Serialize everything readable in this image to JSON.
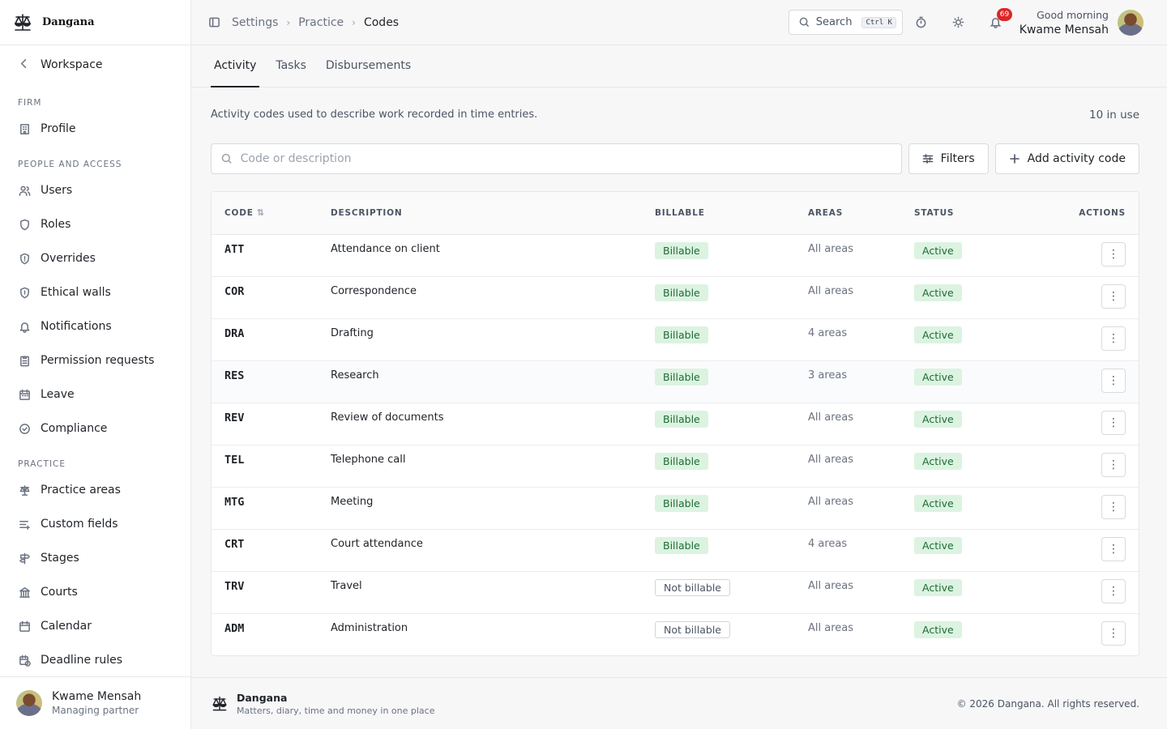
{
  "brand": {
    "name": "Dangana",
    "logo_icon": "scales-of-justice-icon"
  },
  "sidebar": {
    "back_label": "Workspace",
    "sections": [
      {
        "title": "FIRM",
        "items": [
          {
            "label": "Profile",
            "icon": "building-icon"
          }
        ]
      },
      {
        "title": "PEOPLE AND ACCESS",
        "items": [
          {
            "label": "Users",
            "icon": "users-icon"
          },
          {
            "label": "Roles",
            "icon": "shield-icon"
          },
          {
            "label": "Overrides",
            "icon": "shield-alert-icon"
          },
          {
            "label": "Ethical walls",
            "icon": "shield-lock-icon"
          },
          {
            "label": "Notifications",
            "icon": "bell-icon"
          },
          {
            "label": "Permission requests",
            "icon": "clipboard-icon"
          },
          {
            "label": "Leave",
            "icon": "calendar-icon"
          },
          {
            "label": "Compliance",
            "icon": "check-circle-icon"
          }
        ]
      },
      {
        "title": "PRACTICE",
        "items": [
          {
            "label": "Practice areas",
            "icon": "scales-icon"
          },
          {
            "label": "Custom fields",
            "icon": "list-plus-icon"
          },
          {
            "label": "Stages",
            "icon": "signpost-icon"
          },
          {
            "label": "Courts",
            "icon": "landmark-icon"
          },
          {
            "label": "Calendar",
            "icon": "calendar-icon"
          },
          {
            "label": "Deadline rules",
            "icon": "calendar-clock-icon"
          }
        ]
      }
    ],
    "user": {
      "name": "Kwame Mensah",
      "role": "Managing partner"
    }
  },
  "topbar": {
    "breadcrumbs": [
      "Settings",
      "Practice",
      "Codes"
    ],
    "search_label": "Search",
    "search_shortcut": "Ctrl K",
    "notification_count": "69",
    "greeting": "Good morning",
    "user_name": "Kwame Mensah"
  },
  "tabs": [
    {
      "label": "Activity",
      "active": true
    },
    {
      "label": "Tasks",
      "active": false
    },
    {
      "label": "Disbursements",
      "active": false
    }
  ],
  "main": {
    "intro": "Activity codes used to describe work recorded in time entries.",
    "count": "10 in use",
    "search_placeholder": "Code or description",
    "filters_label": "Filters",
    "add_label": "Add activity code"
  },
  "table": {
    "headers": {
      "code": "CODE",
      "description": "DESCRIPTION",
      "billable": "BILLABLE",
      "areas": "AREAS",
      "status": "STATUS",
      "actions": "ACTIONS"
    },
    "rows": [
      {
        "code": "ATT",
        "description": "Attendance on client",
        "billable": "Billable",
        "areas": "All areas",
        "status": "Active"
      },
      {
        "code": "COR",
        "description": "Correspondence",
        "billable": "Billable",
        "areas": "All areas",
        "status": "Active"
      },
      {
        "code": "DRA",
        "description": "Drafting",
        "billable": "Billable",
        "areas": "4 areas",
        "status": "Active"
      },
      {
        "code": "RES",
        "description": "Research",
        "billable": "Billable",
        "areas": "3 areas",
        "status": "Active"
      },
      {
        "code": "REV",
        "description": "Review of documents",
        "billable": "Billable",
        "areas": "All areas",
        "status": "Active"
      },
      {
        "code": "TEL",
        "description": "Telephone call",
        "billable": "Billable",
        "areas": "All areas",
        "status": "Active"
      },
      {
        "code": "MTG",
        "description": "Meeting",
        "billable": "Billable",
        "areas": "All areas",
        "status": "Active"
      },
      {
        "code": "CRT",
        "description": "Court attendance",
        "billable": "Billable",
        "areas": "4 areas",
        "status": "Active"
      },
      {
        "code": "TRV",
        "description": "Travel",
        "billable": "Not billable",
        "areas": "All areas",
        "status": "Active"
      },
      {
        "code": "ADM",
        "description": "Administration",
        "billable": "Not billable",
        "areas": "All areas",
        "status": "Active"
      }
    ]
  },
  "footer": {
    "name": "Dangana",
    "tagline": "Matters, diary, time and money in one place",
    "copyright": "© 2026 Dangana. All rights reserved."
  },
  "colors": {
    "billable_bg": "#dcf3e1",
    "billable_text": "#1e6b35",
    "badge": "#dc2626"
  }
}
